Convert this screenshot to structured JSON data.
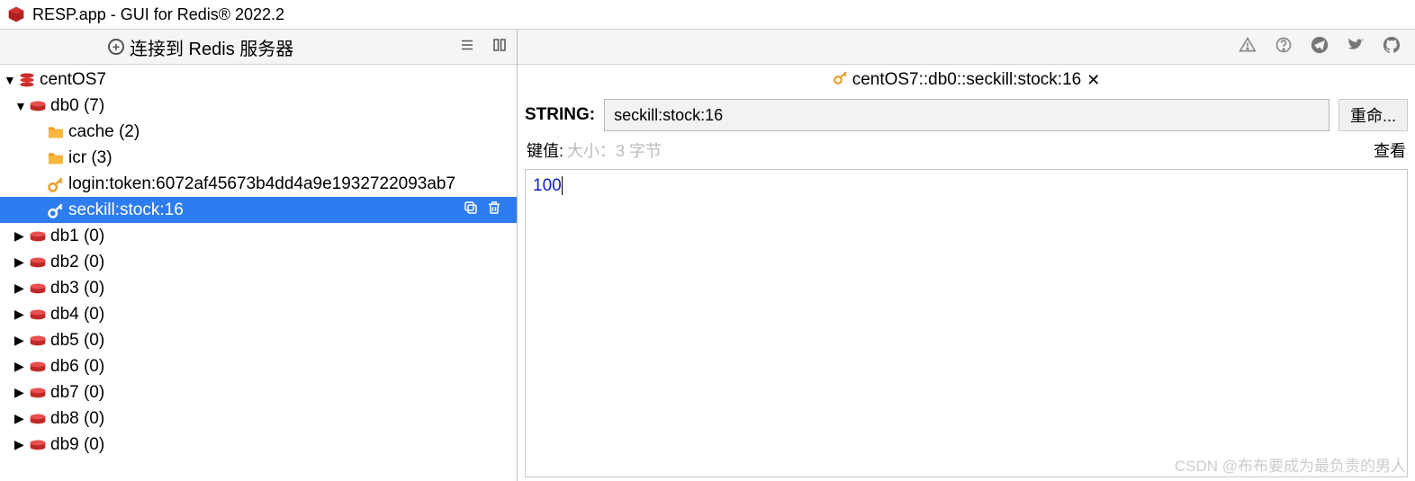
{
  "title": "RESP.app - GUI for Redis® 2022.2",
  "toolbar": {
    "connect": "连接到 Redis 服务器"
  },
  "server": "centOS7",
  "tree": [
    {
      "type": "db",
      "label": "db0  (7)",
      "expanded": true
    },
    {
      "type": "folder",
      "label": "cache (2)"
    },
    {
      "type": "folder",
      "label": "icr (3)"
    },
    {
      "type": "key",
      "label": "login:token:6072af45673b4dd4a9e1932722093ab7"
    },
    {
      "type": "key",
      "label": "seckill:stock:16",
      "selected": true
    },
    {
      "type": "db",
      "label": "db1  (0)"
    },
    {
      "type": "db",
      "label": "db2  (0)"
    },
    {
      "type": "db",
      "label": "db3  (0)"
    },
    {
      "type": "db",
      "label": "db4  (0)"
    },
    {
      "type": "db",
      "label": "db5  (0)"
    },
    {
      "type": "db",
      "label": "db6  (0)"
    },
    {
      "type": "db",
      "label": "db7  (0)"
    },
    {
      "type": "db",
      "label": "db8  (0)"
    },
    {
      "type": "db",
      "label": "db9  (0)"
    }
  ],
  "detail": {
    "breadcrumb": "centOS7::db0::seckill:stock:16",
    "type_label": "STRING:",
    "key_name": "seckill:stock:16",
    "rename_btn": "重命...",
    "meta_label": "键值:",
    "size_text": "大小：3 字节",
    "view_btn": "查看",
    "value": "100"
  },
  "watermark": "CSDN @布布要成为最负责的男人"
}
